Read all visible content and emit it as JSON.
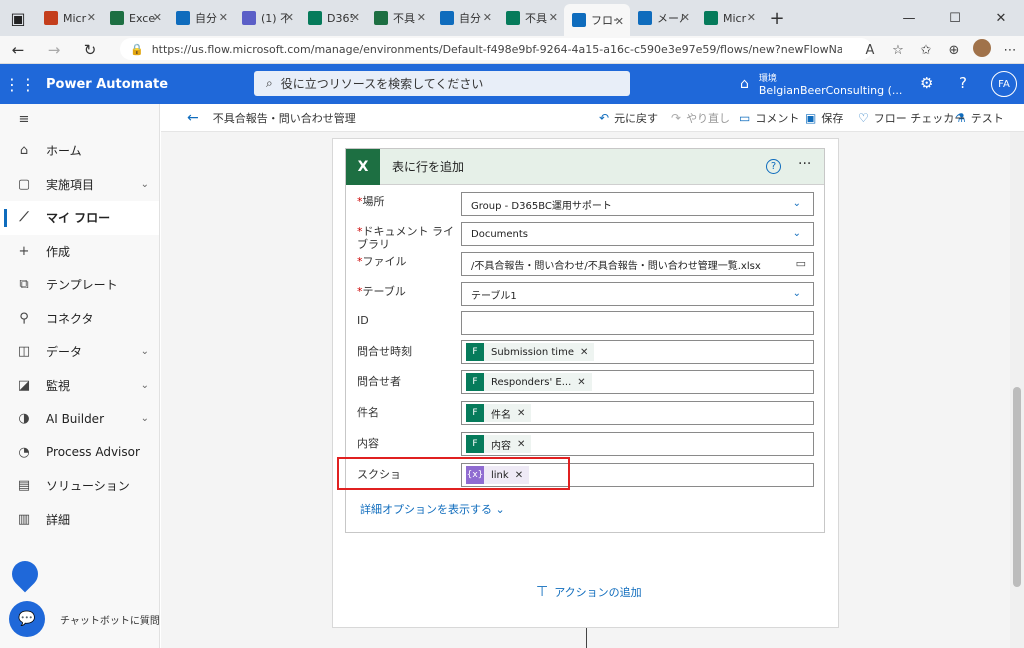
{
  "browser": {
    "tabs": [
      {
        "label": "Micr",
        "color": "#c43e1c"
      },
      {
        "label": "Excel",
        "color": "#1d6f42"
      },
      {
        "label": "自分",
        "color": "#0f6cbd"
      },
      {
        "label": "(1) 不",
        "color": "#5b5fc7"
      },
      {
        "label": "D365",
        "color": "#067b5b"
      },
      {
        "label": "不具",
        "color": "#1d6f42"
      },
      {
        "label": "自分",
        "color": "#0f6cbd"
      },
      {
        "label": "不具",
        "color": "#067b5b"
      },
      {
        "label": "フロー",
        "color": "#0f6cbd",
        "active": true
      },
      {
        "label": "メール",
        "color": "#0f6cbd"
      },
      {
        "label": "Micr",
        "color": "#067b5b"
      }
    ],
    "url": "https://us.flow.microsoft.com/manage/environments/Default-f498e9bf-9264-4a15-a16c-c590e3e97e59/flows/new?newFlowName..."
  },
  "header": {
    "app_name": "Power Automate",
    "search_placeholder": "役に立つリソースを検索してください",
    "env_label": "環境",
    "env_name": "BelgianBeerConsulting (...",
    "avatar": "FA"
  },
  "sidebar": {
    "items": [
      {
        "label": "ホーム",
        "icon": "⌂"
      },
      {
        "label": "実施項目",
        "icon": "▢",
        "chevron": true
      },
      {
        "label": "マイ フロー",
        "icon": "⟋",
        "active": true
      },
      {
        "label": "作成",
        "icon": "+"
      },
      {
        "label": "テンプレート",
        "icon": "⧉"
      },
      {
        "label": "コネクタ",
        "icon": "⚲"
      },
      {
        "label": "データ",
        "icon": "◫",
        "chevron": true
      },
      {
        "label": "監視",
        "icon": "◪",
        "chevron": true
      },
      {
        "label": "AI Builder",
        "icon": "◑",
        "chevron": true
      },
      {
        "label": "Process Advisor",
        "icon": "◔"
      },
      {
        "label": "ソリューション",
        "icon": "▤"
      },
      {
        "label": "詳細",
        "icon": "▥"
      }
    ],
    "chatbot_label": "チャットボットに質問"
  },
  "commandbar": {
    "flow_name": "不具合報告・問い合わせ管理",
    "undo": "元に戻す",
    "redo": "やり直し",
    "comment": "コメント",
    "save": "保存",
    "checker": "フロー チェッカー",
    "test": "テスト"
  },
  "card": {
    "title": "表に行を追加",
    "fields": [
      {
        "label": "場所",
        "required": true,
        "value": "Group - D365BC運用サポート",
        "type": "dropdown"
      },
      {
        "label": "ドキュメント ライブラリ",
        "required": true,
        "value": "Documents",
        "type": "dropdown"
      },
      {
        "label": "ファイル",
        "required": true,
        "value": "/不具合報告・問い合わせ/不具合報告・問い合わせ管理一覧.xlsx",
        "type": "file"
      },
      {
        "label": "テーブル",
        "required": true,
        "value": "テーブル1",
        "type": "dropdown"
      },
      {
        "label": "ID",
        "required": false,
        "value": "",
        "type": "text"
      },
      {
        "label": "問合せ時刻",
        "required": false,
        "token": "Submission time",
        "type": "token"
      },
      {
        "label": "問合せ者",
        "required": false,
        "token": "Responders' E...",
        "type": "token"
      },
      {
        "label": "件名",
        "required": false,
        "token": "件名",
        "type": "token"
      },
      {
        "label": "内容",
        "required": false,
        "token": "内容",
        "type": "token"
      },
      {
        "label": "スクショ",
        "required": false,
        "token": "link",
        "type": "expr"
      }
    ],
    "advanced_options": "詳細オプションを表示する",
    "add_action": "アクションの追加"
  }
}
